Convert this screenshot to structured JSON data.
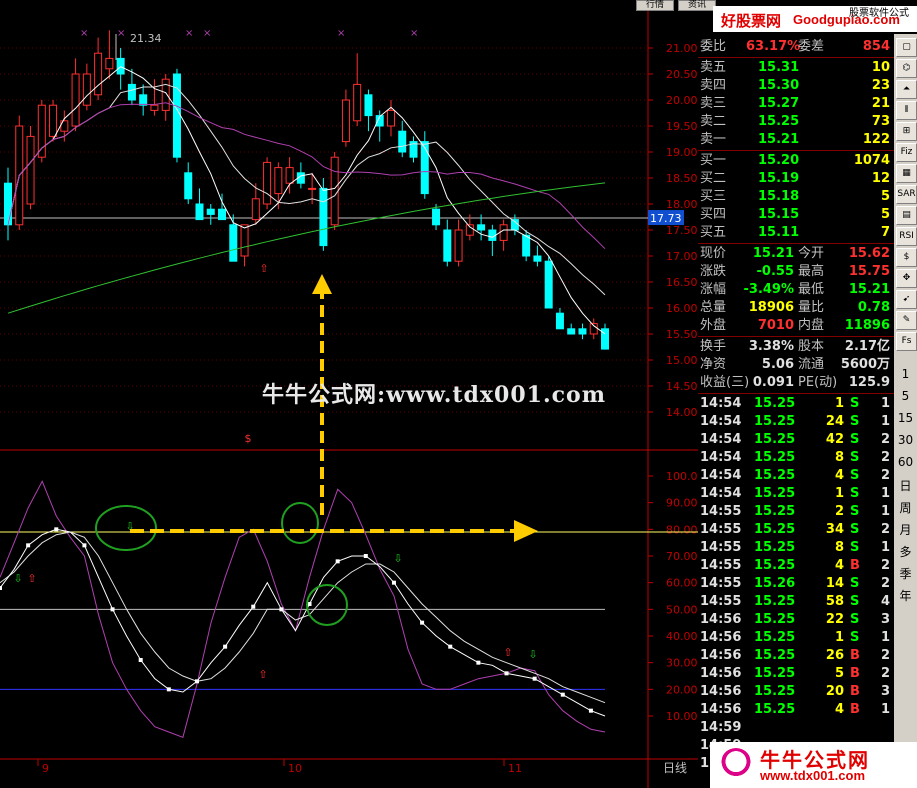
{
  "colors": {
    "up": "#ff3030",
    "down": "#00ffff",
    "ma_white": "#ffffff",
    "ma_purple": "#b040b0",
    "ma_green": "#30c030",
    "axis_red": "#c00000",
    "arrow": "#ffcc00",
    "price_tag": "#1050d0"
  },
  "topbar": {
    "title_fragment": "…资讯工具  …",
    "btn1": "行情",
    "btn2": "资讯",
    "logo_text": "好股票网",
    "logo_url": "Goodgupiao.com",
    "logo_sub": "股票软件公式"
  },
  "chart": {
    "peak_label": "21.34",
    "current_price_tag": "17.73",
    "price_axis": [
      "21.00",
      "20.50",
      "20.00",
      "19.50",
      "19.00",
      "18.50",
      "18.00",
      "17.50",
      "17.00",
      "16.50",
      "16.00",
      "15.50",
      "15.00",
      "14.50",
      "14.00"
    ],
    "indicator_axis": [
      "100.0",
      "90.00",
      "80.00",
      "70.00",
      "60.00",
      "50.00",
      "40.00",
      "30.00",
      "20.00",
      "10.00"
    ],
    "dollar_marker": "$",
    "x_labels": [
      "9",
      "10",
      "11"
    ],
    "period_label": "日线",
    "watermark": "牛牛公式网:www.tdx001.com"
  },
  "chart_data": {
    "type": "candlestick",
    "candles": [
      {
        "o": 18.4,
        "h": 18.7,
        "l": 17.3,
        "c": 17.6
      },
      {
        "o": 17.6,
        "h": 19.7,
        "l": 17.5,
        "c": 19.5
      },
      {
        "o": 18.0,
        "h": 19.5,
        "l": 17.9,
        "c": 19.3
      },
      {
        "o": 18.9,
        "h": 20.0,
        "l": 18.8,
        "c": 19.9
      },
      {
        "o": 19.3,
        "h": 20.0,
        "l": 19.2,
        "c": 19.9
      },
      {
        "o": 19.4,
        "h": 19.8,
        "l": 19.2,
        "c": 19.6
      },
      {
        "o": 19.5,
        "h": 20.8,
        "l": 19.4,
        "c": 20.5
      },
      {
        "o": 19.9,
        "h": 20.7,
        "l": 19.8,
        "c": 20.5
      },
      {
        "o": 20.1,
        "h": 21.2,
        "l": 20.0,
        "c": 20.9
      },
      {
        "o": 20.6,
        "h": 21.34,
        "l": 20.4,
        "c": 20.8
      },
      {
        "o": 20.8,
        "h": 21.0,
        "l": 20.2,
        "c": 20.5
      },
      {
        "o": 20.3,
        "h": 20.6,
        "l": 19.9,
        "c": 20.0
      },
      {
        "o": 20.1,
        "h": 20.3,
        "l": 19.7,
        "c": 19.9
      },
      {
        "o": 19.8,
        "h": 20.4,
        "l": 19.7,
        "c": 19.9
      },
      {
        "o": 19.8,
        "h": 20.5,
        "l": 19.6,
        "c": 20.4
      },
      {
        "o": 20.5,
        "h": 20.6,
        "l": 18.8,
        "c": 18.9
      },
      {
        "o": 18.6,
        "h": 18.8,
        "l": 18.0,
        "c": 18.1
      },
      {
        "o": 18.0,
        "h": 18.3,
        "l": 17.7,
        "c": 17.7
      },
      {
        "o": 17.9,
        "h": 18.0,
        "l": 17.6,
        "c": 17.8
      },
      {
        "o": 17.9,
        "h": 18.2,
        "l": 17.7,
        "c": 17.7
      },
      {
        "o": 17.6,
        "h": 17.8,
        "l": 16.9,
        "c": 16.9
      },
      {
        "o": 17.0,
        "h": 17.6,
        "l": 16.8,
        "c": 17.6
      },
      {
        "o": 17.7,
        "h": 18.4,
        "l": 17.6,
        "c": 18.1
      },
      {
        "o": 18.0,
        "h": 18.9,
        "l": 17.9,
        "c": 18.8
      },
      {
        "o": 18.2,
        "h": 18.8,
        "l": 17.9,
        "c": 18.7
      },
      {
        "o": 18.4,
        "h": 18.9,
        "l": 18.2,
        "c": 18.7
      },
      {
        "o": 18.6,
        "h": 18.8,
        "l": 18.3,
        "c": 18.4
      },
      {
        "o": 18.3,
        "h": 18.6,
        "l": 18.0,
        "c": 18.3
      },
      {
        "o": 18.3,
        "h": 18.5,
        "l": 17.1,
        "c": 17.2
      },
      {
        "o": 17.6,
        "h": 19.0,
        "l": 17.5,
        "c": 18.9
      },
      {
        "o": 19.2,
        "h": 20.2,
        "l": 19.1,
        "c": 20.0
      },
      {
        "o": 19.6,
        "h": 20.9,
        "l": 19.5,
        "c": 20.3
      },
      {
        "o": 20.1,
        "h": 20.2,
        "l": 19.4,
        "c": 19.7
      },
      {
        "o": 19.7,
        "h": 19.8,
        "l": 19.2,
        "c": 19.5
      },
      {
        "o": 19.5,
        "h": 20.0,
        "l": 19.3,
        "c": 19.8
      },
      {
        "o": 19.4,
        "h": 19.6,
        "l": 18.9,
        "c": 19.0
      },
      {
        "o": 19.2,
        "h": 19.3,
        "l": 18.8,
        "c": 18.9
      },
      {
        "o": 19.2,
        "h": 19.4,
        "l": 18.1,
        "c": 18.2
      },
      {
        "o": 17.9,
        "h": 18.0,
        "l": 17.5,
        "c": 17.6
      },
      {
        "o": 17.5,
        "h": 17.7,
        "l": 16.8,
        "c": 16.9
      },
      {
        "o": 16.9,
        "h": 17.7,
        "l": 16.8,
        "c": 17.5
      },
      {
        "o": 17.4,
        "h": 17.8,
        "l": 17.3,
        "c": 17.6
      },
      {
        "o": 17.6,
        "h": 17.8,
        "l": 17.3,
        "c": 17.5
      },
      {
        "o": 17.5,
        "h": 17.6,
        "l": 17.0,
        "c": 17.3
      },
      {
        "o": 17.3,
        "h": 17.7,
        "l": 17.1,
        "c": 17.6
      },
      {
        "o": 17.7,
        "h": 17.8,
        "l": 17.4,
        "c": 17.5
      },
      {
        "o": 17.4,
        "h": 17.5,
        "l": 16.9,
        "c": 17.0
      },
      {
        "o": 17.0,
        "h": 17.2,
        "l": 16.8,
        "c": 16.9
      },
      {
        "o": 16.9,
        "h": 17.0,
        "l": 16.0,
        "c": 16.0
      },
      {
        "o": 15.9,
        "h": 16.0,
        "l": 15.6,
        "c": 15.6
      },
      {
        "o": 15.6,
        "h": 15.7,
        "l": 15.5,
        "c": 15.5
      },
      {
        "o": 15.6,
        "h": 15.7,
        "l": 15.4,
        "c": 15.5
      },
      {
        "o": 15.5,
        "h": 15.8,
        "l": 15.4,
        "c": 15.7
      },
      {
        "o": 15.6,
        "h": 15.7,
        "l": 15.2,
        "c": 15.21
      }
    ],
    "ylim": [
      14.0,
      21.5
    ],
    "indicator_ylim": [
      0,
      105
    ],
    "indicator_k": [
      58,
      65,
      74,
      78,
      80,
      79,
      74,
      62,
      50,
      40,
      31,
      24,
      20,
      19,
      23,
      30,
      36,
      44,
      51,
      60,
      50,
      42,
      52,
      62,
      68,
      70,
      70,
      66,
      60,
      52,
      45,
      40,
      36,
      33,
      30,
      29,
      26,
      25,
      24,
      21,
      18,
      15,
      12,
      10
    ],
    "indicator_d": [
      60,
      64,
      70,
      75,
      78,
      79,
      77,
      70,
      60,
      50,
      41,
      34,
      28,
      25,
      23,
      24,
      28,
      34,
      41,
      50,
      50,
      46,
      48,
      54,
      60,
      64,
      67,
      67,
      64,
      58,
      52,
      47,
      42,
      38,
      35,
      32,
      30,
      28,
      26,
      24,
      21,
      19,
      17,
      15
    ],
    "indicator_j": [
      62,
      75,
      88,
      98,
      85,
      77,
      70,
      48,
      30,
      20,
      12,
      6,
      4,
      2,
      22,
      45,
      62,
      77,
      80,
      68,
      52,
      42,
      62,
      80,
      95,
      90,
      78,
      65,
      55,
      35,
      22,
      20,
      20,
      22,
      24,
      25,
      26,
      28,
      27,
      18,
      12,
      8,
      5,
      4
    ],
    "yellow_level": 79,
    "white_level": 50,
    "blue_level": 20
  },
  "panel": {
    "weibi": {
      "label": "委比",
      "value": "63.17%",
      "label2": "委差",
      "value2": "854"
    },
    "sells": [
      {
        "label": "卖五",
        "price": "15.31",
        "vol": "10"
      },
      {
        "label": "卖四",
        "price": "15.30",
        "vol": "23"
      },
      {
        "label": "卖三",
        "price": "15.27",
        "vol": "21"
      },
      {
        "label": "卖二",
        "price": "15.25",
        "vol": "73"
      },
      {
        "label": "卖一",
        "price": "15.21",
        "vol": "122"
      }
    ],
    "buys": [
      {
        "label": "买一",
        "price": "15.20",
        "vol": "1074"
      },
      {
        "label": "买二",
        "price": "15.19",
        "vol": "12"
      },
      {
        "label": "买三",
        "price": "15.18",
        "vol": "5"
      },
      {
        "label": "买四",
        "price": "15.15",
        "vol": "5"
      },
      {
        "label": "买五",
        "price": "15.11",
        "vol": "7"
      }
    ],
    "quote": [
      {
        "l1": "现价",
        "v1": "15.21",
        "l2": "今开",
        "v2": "15.62",
        "c1": "#00ff00",
        "c2": "#ff3030"
      },
      {
        "l1": "涨跌",
        "v1": "-0.55",
        "l2": "最高",
        "v2": "15.75",
        "c1": "#00ff00",
        "c2": "#ff3030"
      },
      {
        "l1": "涨幅",
        "v1": "-3.49%",
        "l2": "最低",
        "v2": "15.21",
        "c1": "#00ff00",
        "c2": "#00ff00"
      },
      {
        "l1": "总量",
        "v1": "18906",
        "l2": "量比",
        "v2": "0.78",
        "c1": "#ffff00",
        "c2": "#00ff00"
      },
      {
        "l1": "外盘",
        "v1": "7010",
        "l2": "内盘",
        "v2": "11896",
        "c1": "#ff3030",
        "c2": "#00ff00"
      }
    ],
    "fund": [
      {
        "l1": "换手",
        "v1": "3.38%",
        "l2": "股本",
        "v2": "2.17亿"
      },
      {
        "l1": "净资",
        "v1": "5.06",
        "l2": "流通",
        "v2": "5600万"
      },
      {
        "l1": "收益(三)",
        "v1": "0.091",
        "l2": "PE(动)",
        "v2": "125.9"
      }
    ],
    "ticks": [
      {
        "t": "14:54",
        "p": "15.25",
        "v": "1",
        "s": "S",
        "n": "1"
      },
      {
        "t": "14:54",
        "p": "15.25",
        "v": "24",
        "s": "S",
        "n": "1"
      },
      {
        "t": "14:54",
        "p": "15.25",
        "v": "42",
        "s": "S",
        "n": "2"
      },
      {
        "t": "14:54",
        "p": "15.25",
        "v": "8",
        "s": "S",
        "n": "2"
      },
      {
        "t": "14:54",
        "p": "15.25",
        "v": "4",
        "s": "S",
        "n": "2"
      },
      {
        "t": "14:54",
        "p": "15.25",
        "v": "1",
        "s": "S",
        "n": "1"
      },
      {
        "t": "14:55",
        "p": "15.25",
        "v": "2",
        "s": "S",
        "n": "1"
      },
      {
        "t": "14:55",
        "p": "15.25",
        "v": "34",
        "s": "S",
        "n": "2"
      },
      {
        "t": "14:55",
        "p": "15.25",
        "v": "8",
        "s": "S",
        "n": "1"
      },
      {
        "t": "14:55",
        "p": "15.25",
        "v": "4",
        "s": "B",
        "n": "2"
      },
      {
        "t": "14:55",
        "p": "15.26",
        "v": "14",
        "s": "S",
        "n": "2"
      },
      {
        "t": "14:55",
        "p": "15.25",
        "v": "58",
        "s": "S",
        "n": "4"
      },
      {
        "t": "14:56",
        "p": "15.25",
        "v": "22",
        "s": "S",
        "n": "3"
      },
      {
        "t": "14:56",
        "p": "15.25",
        "v": "1",
        "s": "S",
        "n": "1"
      },
      {
        "t": "14:56",
        "p": "15.25",
        "v": "26",
        "s": "B",
        "n": "2"
      },
      {
        "t": "14:56",
        "p": "15.25",
        "v": "5",
        "s": "B",
        "n": "2"
      },
      {
        "t": "14:56",
        "p": "15.25",
        "v": "20",
        "s": "B",
        "n": "3"
      },
      {
        "t": "14:56",
        "p": "15.25",
        "v": "4",
        "s": "B",
        "n": "1"
      },
      {
        "t": "14:59",
        "p": "",
        "v": "",
        "s": "",
        "n": ""
      },
      {
        "t": "14:59",
        "p": "",
        "v": "",
        "s": "",
        "n": ""
      },
      {
        "t": "15:00",
        "p": "",
        "v": "",
        "s": "",
        "n": ""
      }
    ]
  },
  "rightbar": {
    "buttons": [
      "▢",
      "⌬",
      "⏶",
      "⫴",
      "⊞",
      "Fiz",
      "▦",
      "SAR",
      "▤",
      "RSI",
      "$",
      "✥",
      "➹",
      "✎",
      "Fs"
    ],
    "tabs": [
      "1",
      "5",
      "15",
      "30",
      "60",
      "日",
      "周",
      "月",
      "多",
      "季",
      "年"
    ]
  },
  "bottom_logo": {
    "line1": "牛牛公式网",
    "line2": "www.tdx001.com"
  }
}
